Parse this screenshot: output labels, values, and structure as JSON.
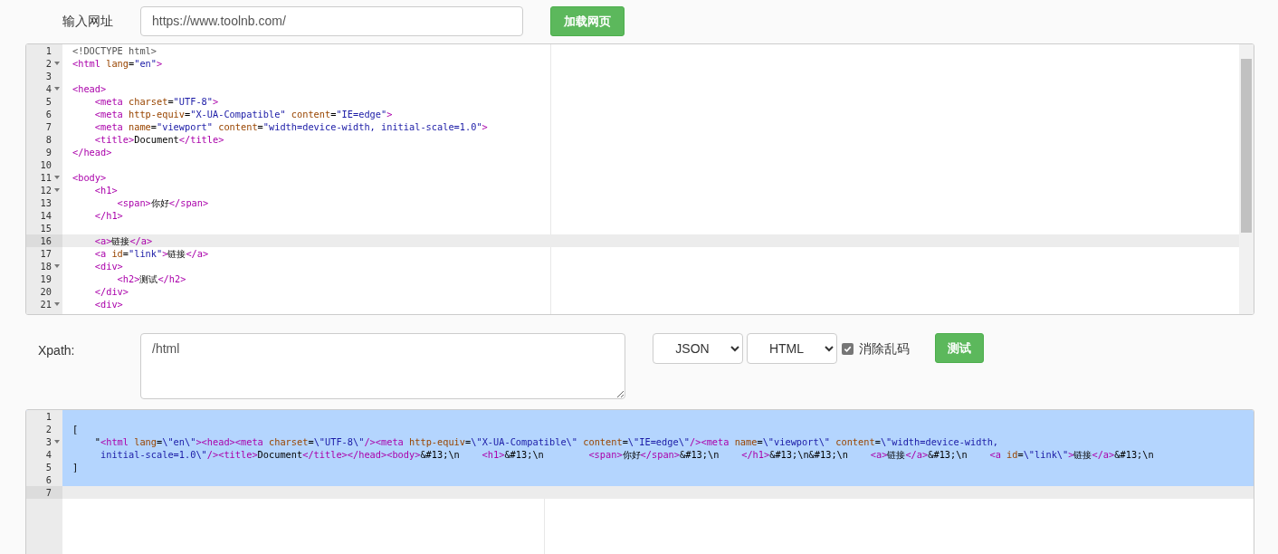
{
  "url_bar": {
    "label": "输入网址",
    "value": "https://www.toolnb.com/",
    "button": "加载网页"
  },
  "source_editor": {
    "lines": [
      {
        "number": "1",
        "fold": false,
        "active": false,
        "tokens": [
          {
            "kind": "doctype",
            "text": "<!DOCTYPE html>"
          }
        ]
      },
      {
        "number": "2",
        "fold": true,
        "active": false,
        "tokens": [
          {
            "kind": "tag",
            "text": "<html"
          },
          {
            "kind": "attr",
            "text": " lang"
          },
          {
            "kind": "text",
            "text": "="
          },
          {
            "kind": "string",
            "text": "\"en\""
          },
          {
            "kind": "tag",
            "text": ">"
          }
        ]
      },
      {
        "number": "3",
        "fold": false,
        "active": false
      },
      {
        "number": "4",
        "fold": true,
        "active": false,
        "tokens": [
          {
            "kind": "tag",
            "text": "<head>"
          }
        ]
      },
      {
        "number": "5",
        "fold": false,
        "active": false,
        "tokens": [
          {
            "kind": "tag",
            "text": "    <meta"
          },
          {
            "kind": "attr",
            "text": " charset"
          },
          {
            "kind": "text",
            "text": "="
          },
          {
            "kind": "string",
            "text": "\"UTF-8\""
          },
          {
            "kind": "tag",
            "text": ">"
          }
        ]
      },
      {
        "number": "6",
        "fold": false,
        "active": false,
        "tokens": [
          {
            "kind": "tag",
            "text": "    <meta"
          },
          {
            "kind": "attr",
            "text": " http-equiv"
          },
          {
            "kind": "text",
            "text": "="
          },
          {
            "kind": "string",
            "text": "\"X-UA-Compatible\""
          },
          {
            "kind": "attr",
            "text": " content"
          },
          {
            "kind": "text",
            "text": "="
          },
          {
            "kind": "string",
            "text": "\"IE=edge\""
          },
          {
            "kind": "tag",
            "text": ">"
          }
        ]
      },
      {
        "number": "7",
        "fold": false,
        "active": false,
        "tokens": [
          {
            "kind": "tag",
            "text": "    <meta"
          },
          {
            "kind": "attr",
            "text": " name"
          },
          {
            "kind": "text",
            "text": "="
          },
          {
            "kind": "string",
            "text": "\"viewport\""
          },
          {
            "kind": "attr",
            "text": " content"
          },
          {
            "kind": "text",
            "text": "="
          },
          {
            "kind": "string",
            "text": "\"width=device-width, initial-scale=1.0\""
          },
          {
            "kind": "tag",
            "text": ">"
          }
        ]
      },
      {
        "number": "8",
        "fold": false,
        "active": false,
        "tokens": [
          {
            "kind": "tag",
            "text": "    <title>"
          },
          {
            "kind": "text",
            "text": "Document"
          },
          {
            "kind": "tag",
            "text": "</title>"
          }
        ]
      },
      {
        "number": "9",
        "fold": false,
        "active": false,
        "tokens": [
          {
            "kind": "tag",
            "text": "</head>"
          }
        ]
      },
      {
        "number": "10",
        "fold": false,
        "active": false
      },
      {
        "number": "11",
        "fold": true,
        "active": false,
        "tokens": [
          {
            "kind": "tag",
            "text": "<body>"
          }
        ]
      },
      {
        "number": "12",
        "fold": true,
        "active": false,
        "tokens": [
          {
            "kind": "tag",
            "text": "    <h1>"
          }
        ]
      },
      {
        "number": "13",
        "fold": false,
        "active": false,
        "tokens": [
          {
            "kind": "tag",
            "text": "        <span>"
          },
          {
            "kind": "text",
            "text": "你好"
          },
          {
            "kind": "tag",
            "text": "</span>"
          }
        ]
      },
      {
        "number": "14",
        "fold": false,
        "active": false,
        "tokens": [
          {
            "kind": "tag",
            "text": "    </h1>"
          }
        ]
      },
      {
        "number": "15",
        "fold": false,
        "active": false
      },
      {
        "number": "16",
        "fold": false,
        "active": true,
        "tokens": [
          {
            "kind": "tag",
            "text": "    <a>"
          },
          {
            "kind": "text",
            "text": "链接"
          },
          {
            "kind": "tag",
            "text": "</a>"
          }
        ]
      },
      {
        "number": "17",
        "fold": false,
        "active": false,
        "tokens": [
          {
            "kind": "tag",
            "text": "    <a"
          },
          {
            "kind": "attr",
            "text": " id"
          },
          {
            "kind": "text",
            "text": "="
          },
          {
            "kind": "string",
            "text": "\"link\""
          },
          {
            "kind": "tag",
            "text": ">"
          },
          {
            "kind": "text",
            "text": "链接"
          },
          {
            "kind": "tag",
            "text": "</a>"
          }
        ]
      },
      {
        "number": "18",
        "fold": true,
        "active": false,
        "tokens": [
          {
            "kind": "tag",
            "text": "    <div>"
          }
        ]
      },
      {
        "number": "19",
        "fold": false,
        "active": false,
        "tokens": [
          {
            "kind": "tag",
            "text": "        <h2>"
          },
          {
            "kind": "text",
            "text": "测试"
          },
          {
            "kind": "tag",
            "text": "</h2>"
          }
        ]
      },
      {
        "number": "20",
        "fold": false,
        "active": false,
        "tokens": [
          {
            "kind": "tag",
            "text": "    </div>"
          }
        ]
      },
      {
        "number": "21",
        "fold": true,
        "active": false,
        "tokens": [
          {
            "kind": "tag",
            "text": "    <div>"
          }
        ]
      }
    ]
  },
  "xpath_bar": {
    "label": "Xpath:",
    "value": "/html",
    "format_select": "JSON",
    "type_select": "HTML",
    "clean_checkbox": {
      "label": "消除乱码",
      "checked": true
    },
    "button": "测试"
  },
  "result_editor": {
    "lines": [
      {
        "number": "1",
        "fold": false,
        "active": false,
        "selected": true
      },
      {
        "number": "2",
        "fold": false,
        "active": false,
        "selected": true,
        "tokens": [
          {
            "kind": "text",
            "text": "["
          }
        ]
      },
      {
        "number": "3",
        "fold": true,
        "active": false,
        "selected": true,
        "tokens": [
          {
            "kind": "text",
            "text": "    \""
          },
          {
            "kind": "tag",
            "text": "<html"
          },
          {
            "kind": "attr",
            "text": " lang"
          },
          {
            "kind": "text",
            "text": "="
          },
          {
            "kind": "string",
            "text": "\\\"en\\\""
          },
          {
            "kind": "tag",
            "text": "><head><meta"
          },
          {
            "kind": "attr",
            "text": " charset"
          },
          {
            "kind": "text",
            "text": "="
          },
          {
            "kind": "string",
            "text": "\\\"UTF-8\\\""
          },
          {
            "kind": "tag",
            "text": "/><meta"
          },
          {
            "kind": "attr",
            "text": " http-equiv"
          },
          {
            "kind": "text",
            "text": "="
          },
          {
            "kind": "string",
            "text": "\\\"X-UA-Compatible\\\""
          },
          {
            "kind": "attr",
            "text": " content"
          },
          {
            "kind": "text",
            "text": "="
          },
          {
            "kind": "string",
            "text": "\\\"IE=edge\\\""
          },
          {
            "kind": "tag",
            "text": "/><meta"
          },
          {
            "kind": "attr",
            "text": " name"
          },
          {
            "kind": "text",
            "text": "="
          },
          {
            "kind": "string",
            "text": "\\\"viewport\\\""
          },
          {
            "kind": "attr",
            "text": " content"
          },
          {
            "kind": "text",
            "text": "="
          },
          {
            "kind": "string",
            "text": "\\\"width=device-width,"
          }
        ]
      },
      {
        "number": "4",
        "fold": false,
        "active": false,
        "selected": true,
        "tokens": [
          {
            "kind": "string",
            "text": "     initial-scale=1.0\\\""
          },
          {
            "kind": "tag",
            "text": "/><title>"
          },
          {
            "kind": "text",
            "text": "Document"
          },
          {
            "kind": "tag",
            "text": "</title></head><body>"
          },
          {
            "kind": "text",
            "text": "&#13;\\n    "
          },
          {
            "kind": "tag",
            "text": "<h1>"
          },
          {
            "kind": "text",
            "text": "&#13;\\n        "
          },
          {
            "kind": "tag",
            "text": "<span>"
          },
          {
            "kind": "text",
            "text": "你好"
          },
          {
            "kind": "tag",
            "text": "</span>"
          },
          {
            "kind": "text",
            "text": "&#13;\\n    "
          },
          {
            "kind": "tag",
            "text": "</h1>"
          },
          {
            "kind": "text",
            "text": "&#13;\\n&#13;\\n    "
          },
          {
            "kind": "tag",
            "text": "<a>"
          },
          {
            "kind": "text",
            "text": "链接"
          },
          {
            "kind": "tag",
            "text": "</a>"
          },
          {
            "kind": "text",
            "text": "&#13;\\n    "
          },
          {
            "kind": "tag",
            "text": "<a"
          },
          {
            "kind": "attr",
            "text": " id"
          },
          {
            "kind": "text",
            "text": "="
          },
          {
            "kind": "string",
            "text": "\\\"link\\\""
          },
          {
            "kind": "tag",
            "text": ">"
          },
          {
            "kind": "text",
            "text": "链接"
          },
          {
            "kind": "tag",
            "text": "</a>"
          },
          {
            "kind": "text",
            "text": "&#13;\\n"
          }
        ]
      },
      {
        "number": "5",
        "fold": false,
        "active": false,
        "selected": true,
        "tokens": [
          {
            "kind": "text",
            "text": "]"
          }
        ]
      },
      {
        "number": "6",
        "fold": false,
        "active": false,
        "selected": true
      },
      {
        "number": "7",
        "fold": false,
        "active": true,
        "selected": false
      }
    ]
  }
}
